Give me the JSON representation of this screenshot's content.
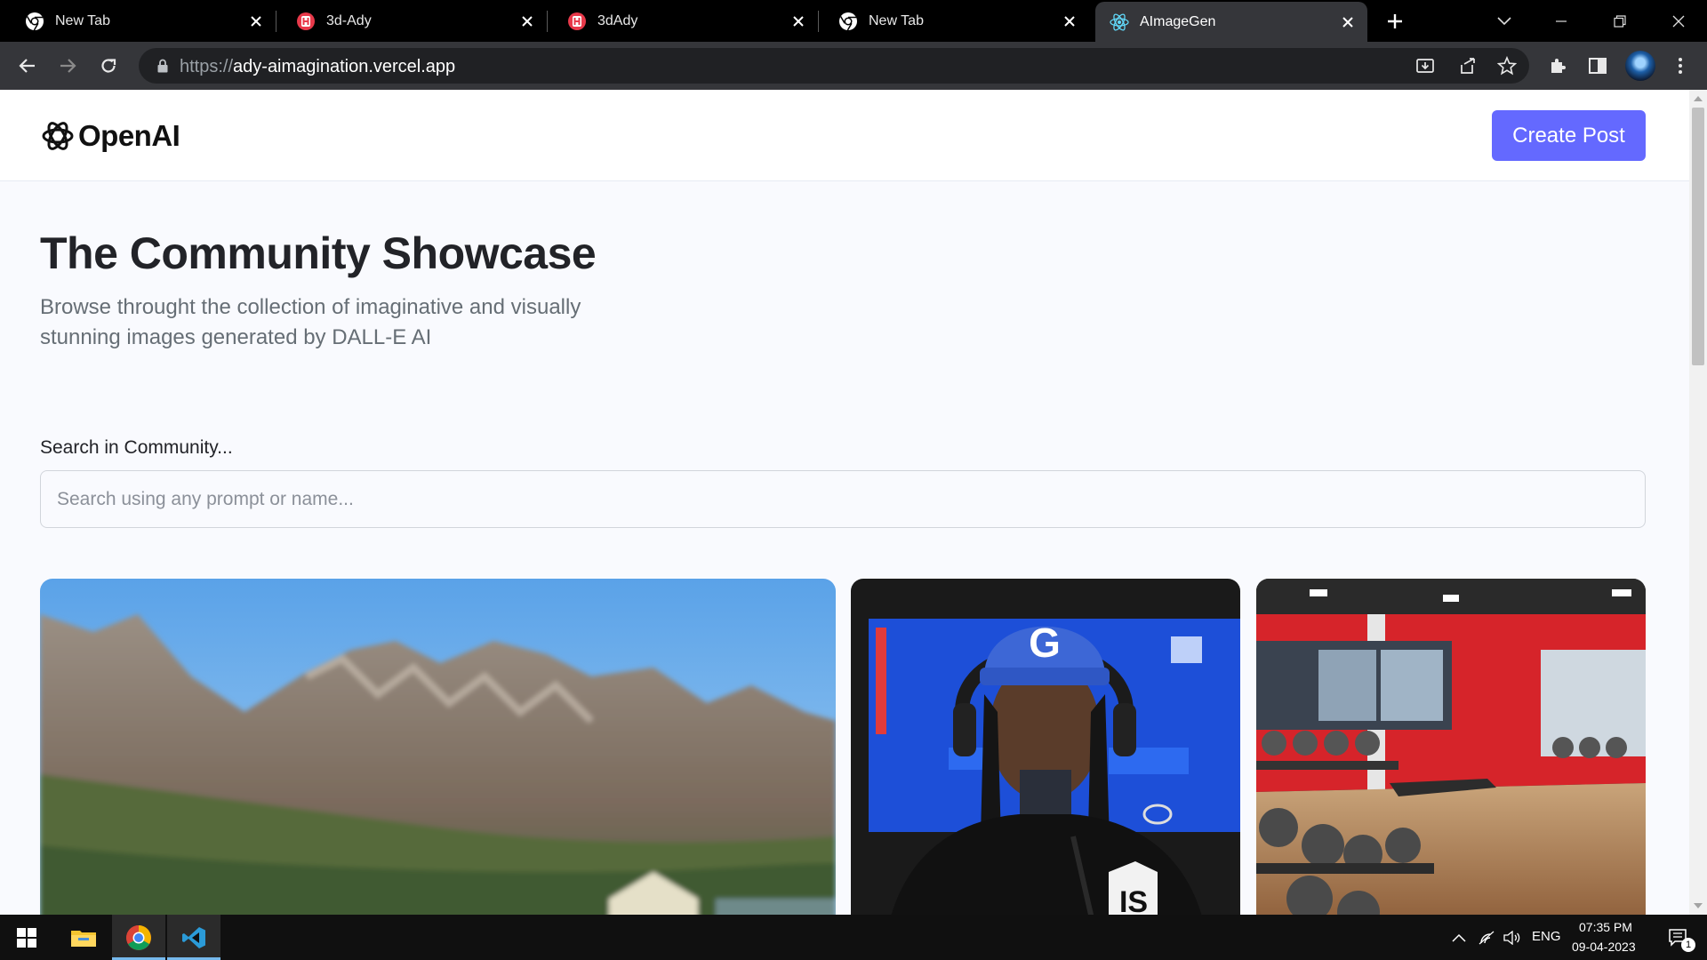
{
  "browser": {
    "tabs": [
      {
        "title": "New Tab",
        "favicon": "chrome-icon"
      },
      {
        "title": "3d-Ady",
        "favicon": "red-h-icon"
      },
      {
        "title": "3dAdy",
        "favicon": "red-h-icon"
      },
      {
        "title": "New Tab",
        "favicon": "chrome-icon"
      },
      {
        "title": "AImageGen",
        "favicon": "react-icon",
        "active": true
      }
    ],
    "url_scheme": "https://",
    "url_host": "ady-aimagination.vercel.app"
  },
  "header": {
    "logo_text": "OpenAI",
    "create_button": "Create Post"
  },
  "main": {
    "title": "The Community Showcase",
    "subtitle": "Browse throught the collection of imaginative and visually stunning images generated by DALL-E AI",
    "search_label": "Search in Community...",
    "search_placeholder": "Search using any prompt or name...",
    "search_value": ""
  },
  "gallery": [
    {
      "subject": "mountain-landscape"
    },
    {
      "subject": "rapper-in-blue-cap"
    },
    {
      "subject": "gym-interior"
    }
  ],
  "taskbar": {
    "apps": [
      "windows-start-icon",
      "file-explorer-icon",
      "chrome-icon",
      "vscode-icon"
    ],
    "language": "ENG",
    "time": "07:35 PM",
    "date": "09-04-2023",
    "notification_count": "1"
  },
  "colors": {
    "accent": "#6469ff",
    "page_bg": "#f9fafe",
    "title": "#222328",
    "subtext": "#666e75"
  }
}
